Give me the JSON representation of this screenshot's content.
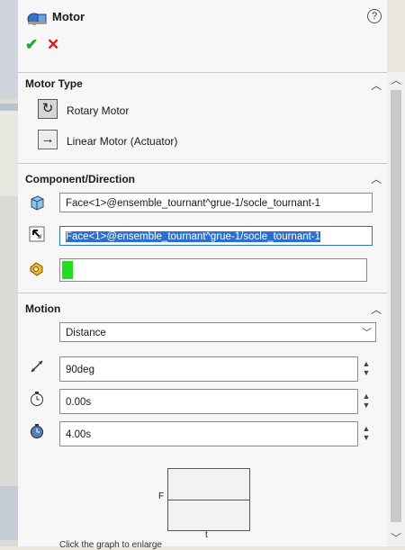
{
  "header": {
    "title": "Motor",
    "help": "?"
  },
  "actions": {
    "ok": "✔",
    "cancel": "✕"
  },
  "motor_type": {
    "title": "Motor Type",
    "rotary_label": "Rotary Motor",
    "linear_label": "Linear Motor (Actuator)"
  },
  "component_direction": {
    "title": "Component/Direction",
    "component_face": "Face<1>@ensemble_tournant^grue-1/socle_tournant-1",
    "direction_face": "Face<1>@ensemble_tournant^grue-1/socle_tournant-1",
    "relative_value": ""
  },
  "motion": {
    "title": "Motion",
    "type_selected": "Distance",
    "distance": "90deg",
    "start_time": "0.00s",
    "duration": "4.00s"
  },
  "graph": {
    "f_label": "F",
    "t_label": "t"
  },
  "footer": {
    "hint": "Click the graph to enlarge"
  },
  "colors": {
    "ok": "#1faa1f",
    "cancel": "#d51a1a",
    "selection": "#2c6fd0",
    "indicator_green": "#22dd22"
  },
  "icons": [
    "motor-icon",
    "help-icon",
    "rotary-icon",
    "linear-arrow-icon",
    "component-icon",
    "direction-icon",
    "relative-icon",
    "distance-icon",
    "start-time-icon",
    "duration-icon"
  ]
}
